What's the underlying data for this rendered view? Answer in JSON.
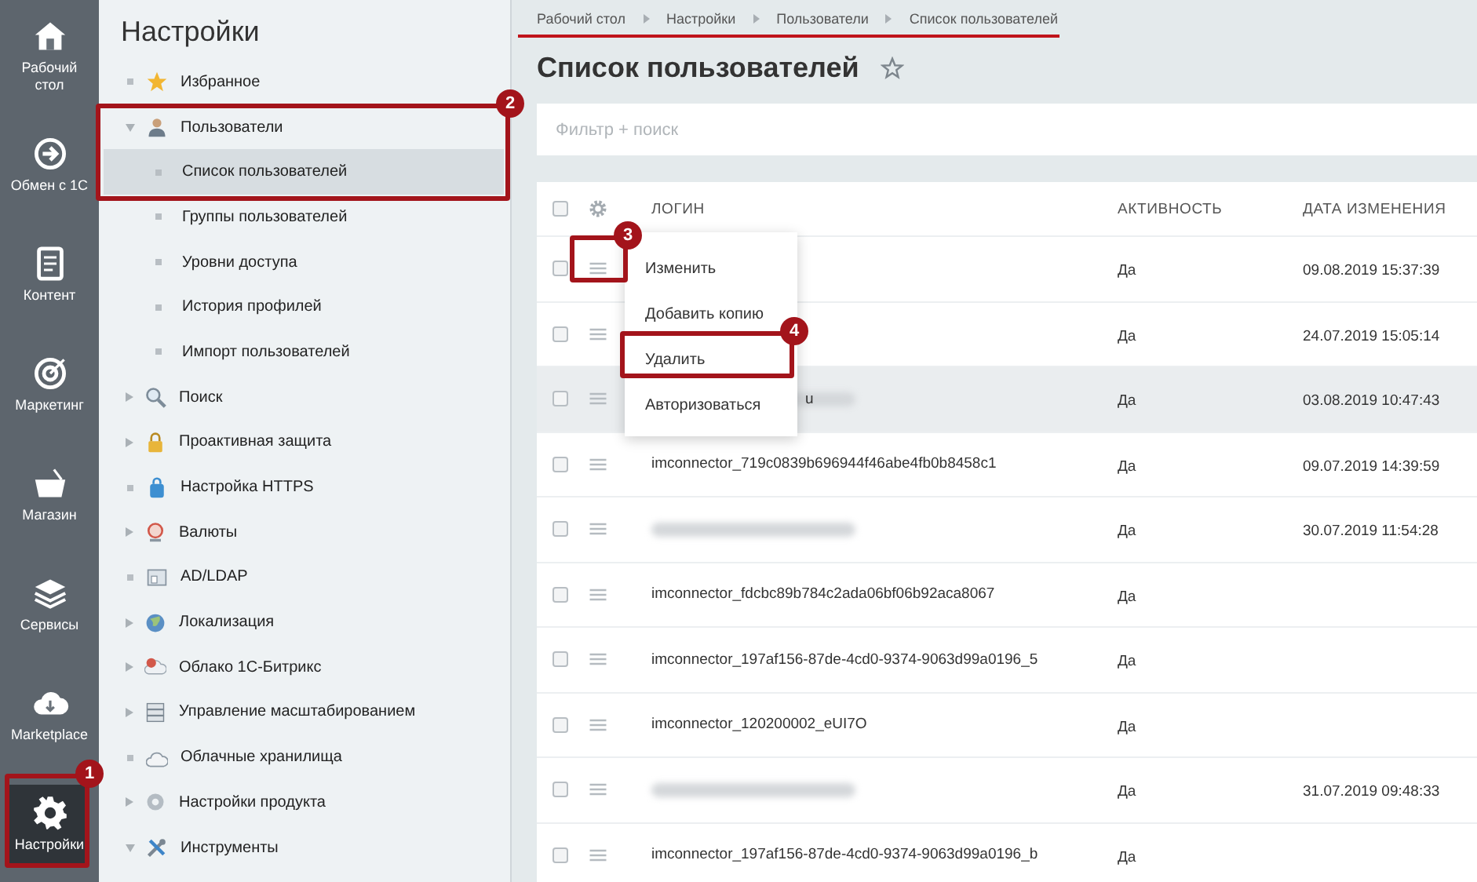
{
  "rail": [
    {
      "label": "Рабочий стол",
      "selected": false
    },
    {
      "label": "Обмен с 1С",
      "selected": false
    },
    {
      "label": "Контент",
      "selected": false
    },
    {
      "label": "Маркетинг",
      "selected": false
    },
    {
      "label": "Магазин",
      "selected": false
    },
    {
      "label": "Сервисы",
      "selected": false
    },
    {
      "label": "Marketplace",
      "selected": false
    },
    {
      "label": "Настройки",
      "selected": true
    }
  ],
  "sidebar": {
    "title": "Настройки",
    "items": [
      {
        "label": "Избранное",
        "kind": "leaf"
      },
      {
        "label": "Пользователи",
        "kind": "folder",
        "expanded": true,
        "children": [
          {
            "label": "Список пользователей",
            "selected": true
          },
          {
            "label": "Группы пользователей",
            "selected": false
          },
          {
            "label": "Уровни доступа",
            "selected": false
          },
          {
            "label": "История профилей",
            "selected": false
          },
          {
            "label": "Импорт пользователей",
            "selected": false
          }
        ]
      },
      {
        "label": "Поиск",
        "kind": "folder",
        "expanded": false
      },
      {
        "label": "Проактивная защита",
        "kind": "folder",
        "expanded": false
      },
      {
        "label": "Настройка HTTPS",
        "kind": "leaf"
      },
      {
        "label": "Валюты",
        "kind": "folder",
        "expanded": false
      },
      {
        "label": "AD/LDAP",
        "kind": "leaf"
      },
      {
        "label": "Локализация",
        "kind": "folder",
        "expanded": false
      },
      {
        "label": "Облако 1С-Битрикс",
        "kind": "folder",
        "expanded": false
      },
      {
        "label": "Управление масштабированием",
        "kind": "folder",
        "expanded": false
      },
      {
        "label": "Облачные хранилища",
        "kind": "leaf"
      },
      {
        "label": "Настройки продукта",
        "kind": "folder",
        "expanded": false
      },
      {
        "label": "Инструменты",
        "kind": "folder",
        "expanded": true
      }
    ]
  },
  "breadcrumbs": [
    "Рабочий стол",
    "Настройки",
    "Пользователи",
    "Список пользователей"
  ],
  "page_title": "Список пользователей",
  "filter": {
    "placeholder": "Фильтр + поиск"
  },
  "table": {
    "header_checked": false,
    "columns": [
      "ЛОГИН",
      "АКТИВНОСТЬ",
      "ДАТА ИЗМЕНЕНИЯ"
    ],
    "rows": [
      {
        "checked": false,
        "hovered": false,
        "active": "Да",
        "date": "09.08.2019 15:37:39"
      },
      {
        "checked": false,
        "hovered": false,
        "active": "Да",
        "date": "24.07.2019 15:05:14"
      },
      {
        "checked": false,
        "hovered": true,
        "login_blurred": true,
        "login_tail": "u",
        "active": "Да",
        "date": "03.08.2019 10:47:43"
      },
      {
        "checked": false,
        "hovered": false,
        "login": "imconnector_719c0839b696944f46abe4fb0b8458c1",
        "active": "Да",
        "date": "09.07.2019 14:39:59"
      },
      {
        "checked": false,
        "hovered": false,
        "login_blurred": true,
        "active": "Да",
        "date": "30.07.2019 11:54:28"
      },
      {
        "checked": false,
        "hovered": false,
        "login": "imconnector_fdcbc89b784c2ada06bf06b92aca8067",
        "active": "Да"
      },
      {
        "checked": false,
        "hovered": false,
        "login": "imconnector_197af156-87de-4cd0-9374-9063d99a0196_5",
        "active": "Да"
      },
      {
        "checked": false,
        "hovered": false,
        "login": "imconnector_120200002_eUI7O",
        "active": "Да"
      },
      {
        "checked": false,
        "hovered": false,
        "login_blurred": true,
        "active": "Да",
        "date": "31.07.2019 09:48:33"
      },
      {
        "checked": false,
        "hovered": false,
        "login": "imconnector_197af156-87de-4cd0-9374-9063d99a0196_b",
        "active": "Да"
      }
    ]
  },
  "context_menu": [
    "Изменить",
    "Добавить копию",
    "Удалить",
    "Авторизоваться"
  ],
  "annotations": [
    {
      "number": "1"
    },
    {
      "number": "2"
    },
    {
      "number": "3"
    },
    {
      "number": "4"
    }
  ]
}
